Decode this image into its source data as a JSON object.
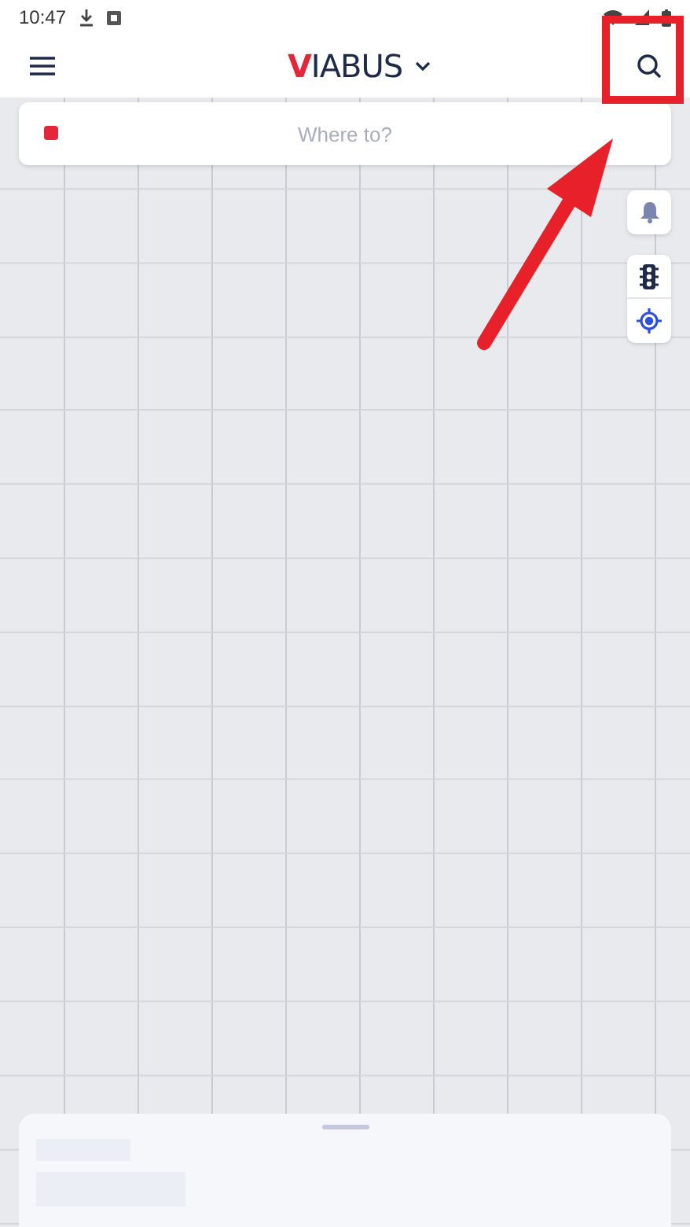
{
  "status_bar": {
    "time": "10:47"
  },
  "header": {
    "logo": "VIABUS"
  },
  "search_field": {
    "placeholder": "Where to?"
  }
}
